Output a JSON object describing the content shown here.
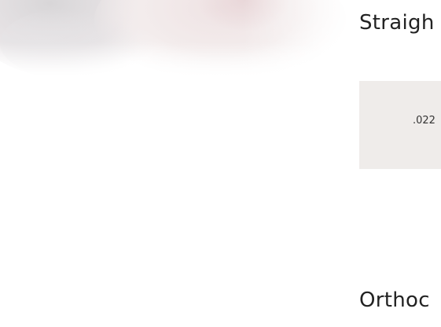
{
  "sections": [
    {
      "heading": "Straigh"
    },
    {
      "heading": "Orthoc"
    }
  ],
  "value_box": {
    "value": ".022"
  }
}
